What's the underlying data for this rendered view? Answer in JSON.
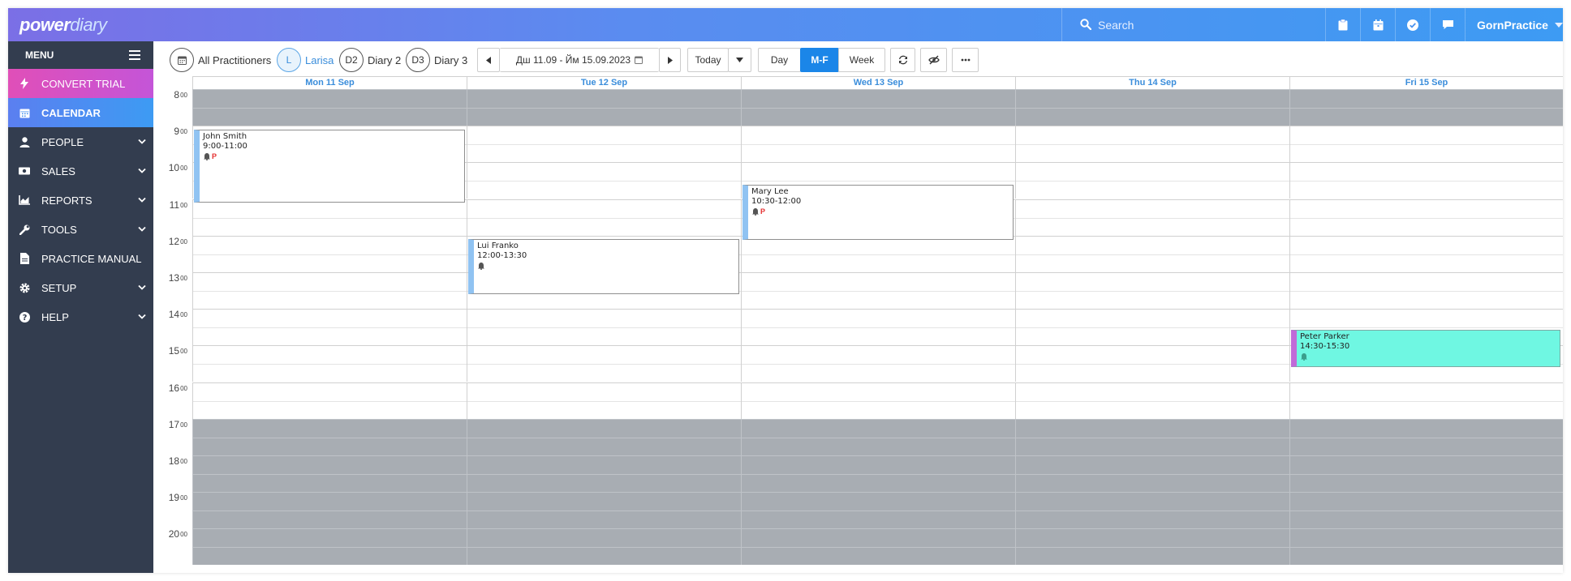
{
  "brand": {
    "part1": "power",
    "part2": "diary"
  },
  "search": {
    "placeholder": "Search"
  },
  "header_icons": [
    "clipboard-icon",
    "calendar-add-icon",
    "check-circle-icon",
    "chat-icon"
  ],
  "practice": {
    "name": "GornPractice"
  },
  "sidebar": {
    "menu_label": "MENU",
    "items": [
      {
        "label": "CONVERT TRIAL",
        "icon": "bolt-icon"
      },
      {
        "label": "CALENDAR",
        "icon": "calendar-icon"
      },
      {
        "label": "PEOPLE",
        "icon": "user-icon"
      },
      {
        "label": "SALES",
        "icon": "money-icon"
      },
      {
        "label": "REPORTS",
        "icon": "chart-icon"
      },
      {
        "label": "TOOLS",
        "icon": "wrench-icon"
      },
      {
        "label": "PRACTICE MANUAL",
        "icon": "document-icon"
      },
      {
        "label": "SETUP",
        "icon": "gear-icon"
      },
      {
        "label": "HELP",
        "icon": "question-icon"
      }
    ]
  },
  "toolbar": {
    "all_practitioners": "All Practitioners",
    "practitioners": [
      {
        "initials": "L",
        "name": "Larisa"
      },
      {
        "initials": "D2",
        "name": "Diary 2"
      },
      {
        "initials": "D3",
        "name": "Diary 3"
      }
    ],
    "date_range": "Дш 11.09 - Йм 15.09.2023",
    "today": "Today",
    "views": [
      "Day",
      "M-F",
      "Week"
    ],
    "active_view": "M-F"
  },
  "calendar": {
    "days": [
      "Mon 11 Sep",
      "Tue 12 Sep",
      "Wed 13 Sep",
      "Thu 14 Sep",
      "Fri 15 Sep"
    ],
    "hours": [
      "8",
      "9",
      "10",
      "11",
      "12",
      "13",
      "14",
      "15",
      "16",
      "17",
      "18",
      "19",
      "20"
    ],
    "minute_suffix": "00",
    "appointments": [
      {
        "name": "John Smith",
        "time": "9:00-11:00",
        "badge": "P"
      },
      {
        "name": "Mary Lee",
        "time": "10:30-12:00",
        "badge": "P"
      },
      {
        "name": "Lui Franko",
        "time": "12:00-13:30",
        "badge": ""
      },
      {
        "name": "Peter Parker",
        "time": "14:30-15:30",
        "badge": ""
      }
    ]
  }
}
